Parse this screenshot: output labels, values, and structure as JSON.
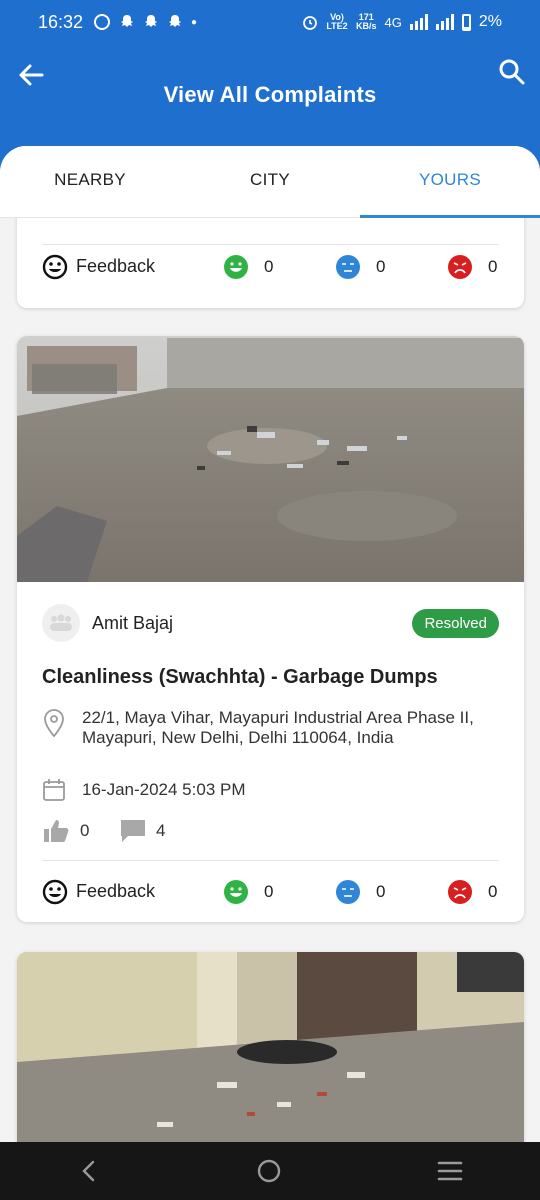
{
  "status_bar": {
    "time": "16:32",
    "network_label": "Vo) LTE2",
    "speed_value": "171",
    "speed_unit": "KB/s",
    "net_type": "4G",
    "battery": "2%"
  },
  "header": {
    "title": "View All Complaints",
    "back_icon": "arrow-left-icon",
    "search_icon": "search-icon"
  },
  "tabs": [
    {
      "label": "NEARBY",
      "active": false
    },
    {
      "label": "CITY",
      "active": false
    },
    {
      "label": "YOURS",
      "active": true
    }
  ],
  "previous_card": {
    "feedback_label": "Feedback",
    "happy_count": "0",
    "neutral_count": "0",
    "angry_count": "0"
  },
  "complaint": {
    "author": "Amit Bajaj",
    "status": "Resolved",
    "title": "Cleanliness (Swachhta) - Garbage Dumps",
    "address": "22/1, Maya Vihar, Mayapuri Industrial Area Phase II, Mayapuri, New Delhi, Delhi 110064, India",
    "date": "16-Jan-2024 5:03 PM",
    "likes": "0",
    "comments": "4",
    "feedback_label": "Feedback",
    "happy_count": "0",
    "neutral_count": "0",
    "angry_count": "0"
  },
  "colors": {
    "primary": "#1f6fcf",
    "tab_active": "#2f86d6",
    "resolved": "#2e9c46",
    "happy": "#2fb344",
    "neutral": "#2f86d6",
    "angry": "#d71f1f"
  },
  "nav": {
    "back_icon": "nav-back-icon",
    "home_icon": "nav-home-icon",
    "menu_icon": "nav-menu-icon"
  }
}
